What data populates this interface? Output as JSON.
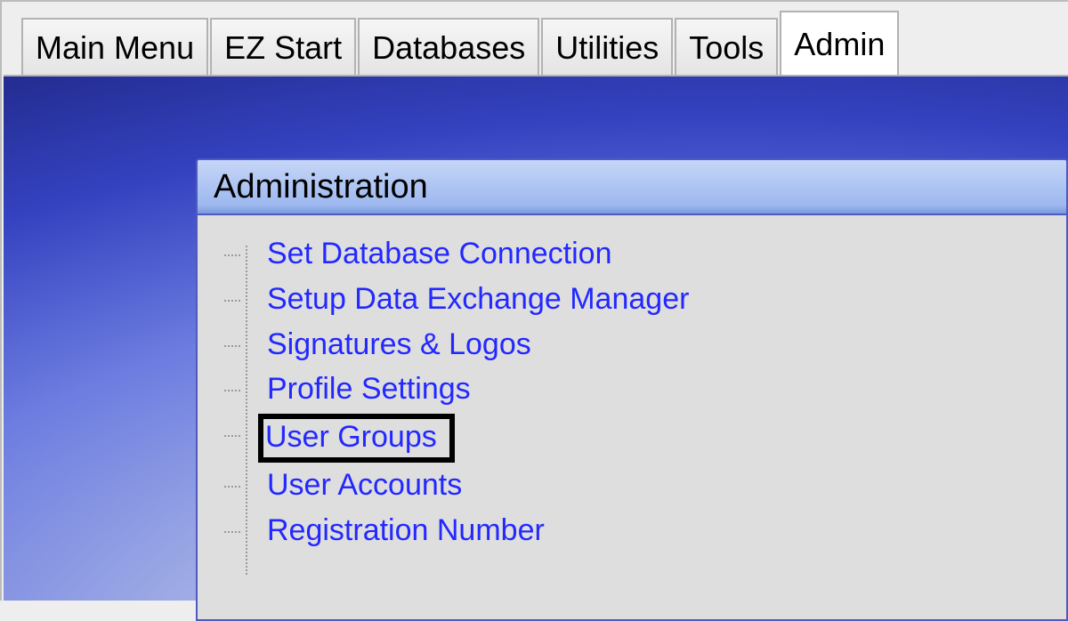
{
  "tabs": [
    {
      "label": "Main Menu"
    },
    {
      "label": "EZ Start"
    },
    {
      "label": "Databases"
    },
    {
      "label": "Utilities"
    },
    {
      "label": "Tools"
    },
    {
      "label": "Admin"
    }
  ],
  "active_tab_index": 5,
  "panel": {
    "title": "Administration",
    "items": [
      {
        "label": "Set Database Connection"
      },
      {
        "label": "Setup Data Exchange Manager"
      },
      {
        "label": "Signatures & Logos"
      },
      {
        "label": "Profile Settings"
      },
      {
        "label": "User Groups",
        "highlighted": true
      },
      {
        "label": "User Accounts"
      },
      {
        "label": "Registration Number"
      }
    ]
  }
}
